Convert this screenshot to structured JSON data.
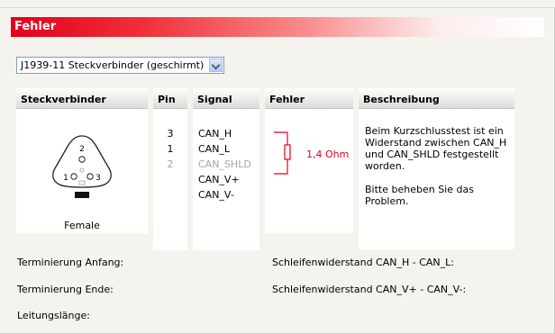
{
  "header": {
    "title": "Fehler"
  },
  "select": {
    "value": "J1939-11 Steckverbinder (geschirmt)"
  },
  "table": {
    "headers": {
      "connector": "Steckverbinder",
      "pin": "Pin",
      "signal": "Signal",
      "error": "Fehler",
      "description": "Beschreibung"
    },
    "connector_label": "Female",
    "pin_numbers": {
      "top": "2",
      "left": "1",
      "right": "3"
    },
    "rows": [
      {
        "pin": "3",
        "signal": "CAN_H",
        "dim": false
      },
      {
        "pin": "1",
        "signal": "CAN_L",
        "dim": false
      },
      {
        "pin": "2",
        "signal": "CAN_SHLD",
        "dim": true
      },
      {
        "pin": "",
        "signal": "CAN_V+",
        "dim": false
      },
      {
        "pin": "",
        "signal": "CAN_V-",
        "dim": false
      }
    ],
    "error_value": "1,4 Ohm",
    "description_lines": [
      "Beim Kurzschlusstest ist ein Widerstand zwischen CAN_H und CAN_SHLD festgestellt worden.",
      "Bitte beheben Sie das Problem."
    ]
  },
  "info": {
    "term_start": "Terminierung Anfang:",
    "term_end": "Terminierung Ende:",
    "cable_length": "Leitungslänge:",
    "loop_h_l": "Schleifenwiderstand CAN_H - CAN_L:",
    "loop_v": "Schleifenwiderstand CAN_V+ - CAN_V-:"
  },
  "colors": {
    "accent": "#e3001b"
  }
}
